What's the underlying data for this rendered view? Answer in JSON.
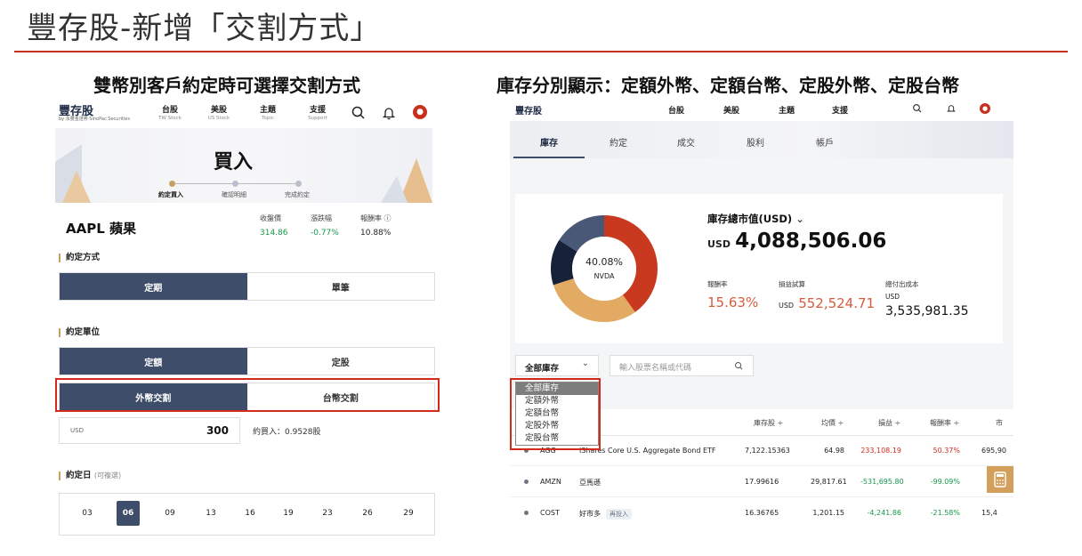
{
  "slide": {
    "title": "豐存股-新增「交割方式」",
    "caption_left": "雙幣別客戶約定時可選擇交割方式",
    "caption_right": "庫存分別顯示：定額外幣、定額台幣、定股外幣、定股台幣"
  },
  "left": {
    "brand": "豐存股",
    "brand_sub": "by 永豐金證券 SinoPac Securities",
    "nav": [
      {
        "zh": "台股",
        "en": "TW Stock"
      },
      {
        "zh": "美股",
        "en": "US Stock"
      },
      {
        "zh": "主題",
        "en": "Topic"
      },
      {
        "zh": "支援",
        "en": "Support"
      }
    ],
    "page_title": "買入",
    "steps": [
      "約定買入",
      "確認明細",
      "完成約定"
    ],
    "stock": "AAPL 蘋果",
    "metrics": [
      {
        "label": "收盤價",
        "value": "314.86",
        "color": "#159a4a"
      },
      {
        "label": "漲跌幅",
        "value": "-0.77%",
        "color": "#159a4a"
      },
      {
        "label": "報酬率",
        "value": "10.88%",
        "color": "#222222"
      }
    ],
    "method": {
      "label": "約定方式",
      "options": [
        "定期",
        "單筆"
      ]
    },
    "unit": {
      "label": "約定單位",
      "options": [
        "定額",
        "定股"
      ]
    },
    "settle": {
      "options": [
        "外幣交割",
        "台幣交割"
      ]
    },
    "amount": {
      "currency": "USD",
      "value": "300",
      "estimate": "約買入：0.9528股"
    },
    "day": {
      "label": "約定日",
      "hint": "(可複選)",
      "days": [
        "03",
        "06",
        "09",
        "13",
        "16",
        "19",
        "23",
        "26",
        "29"
      ],
      "selected": "06"
    }
  },
  "right": {
    "brand": "豐存股",
    "nav": [
      "台股",
      "美股",
      "主題",
      "支援"
    ],
    "tabs": [
      "庫存",
      "約定",
      "成交",
      "股利",
      "帳戶"
    ],
    "donut": {
      "pct": "40.08%",
      "name": "NVDA"
    },
    "total": {
      "title": "庫存總市值(USD)",
      "currency": "USD",
      "value": "4,088,506.06"
    },
    "kpis": [
      {
        "label": "報酬率",
        "currency": "",
        "value": "15.63%"
      },
      {
        "label": "損益試算",
        "currency": "USD",
        "value": "552,524.71"
      },
      {
        "label": "總付出成本",
        "currency": "USD",
        "value": "3,535,981.35"
      }
    ],
    "filter": {
      "selected": "全部庫存",
      "options": [
        "全部庫存",
        "定額外幣",
        "定額台幣",
        "定股外幣",
        "定股台幣"
      ]
    },
    "search_placeholder": "輸入股票名稱或代碼",
    "columns": [
      "庫存股 ÷",
      "均價 ÷",
      "損益 ÷",
      "報酬率 ÷",
      "市"
    ],
    "rows": [
      {
        "code": "AGG",
        "name": "iShares Core U.S. Aggregate Bond ETF",
        "tag": "",
        "shares": "7,122.15363",
        "avg": "64.98",
        "pl": "233,108.19",
        "ret": "50.37%",
        "mkt": "695,90",
        "dir": "pos"
      },
      {
        "code": "AMZN",
        "name": "亞馬遜",
        "tag": "",
        "shares": "17.99616",
        "avg": "29,817.61",
        "pl": "-531,695.80",
        "ret": "-99.09%",
        "mkt": "",
        "dir": "neg"
      },
      {
        "code": "COST",
        "name": "好市多",
        "tag": "再投入",
        "shares": "16.36765",
        "avg": "1,201.15",
        "pl": "-4,241.86",
        "ret": "-21.58%",
        "mkt": "15,4",
        "dir": "neg"
      }
    ]
  }
}
